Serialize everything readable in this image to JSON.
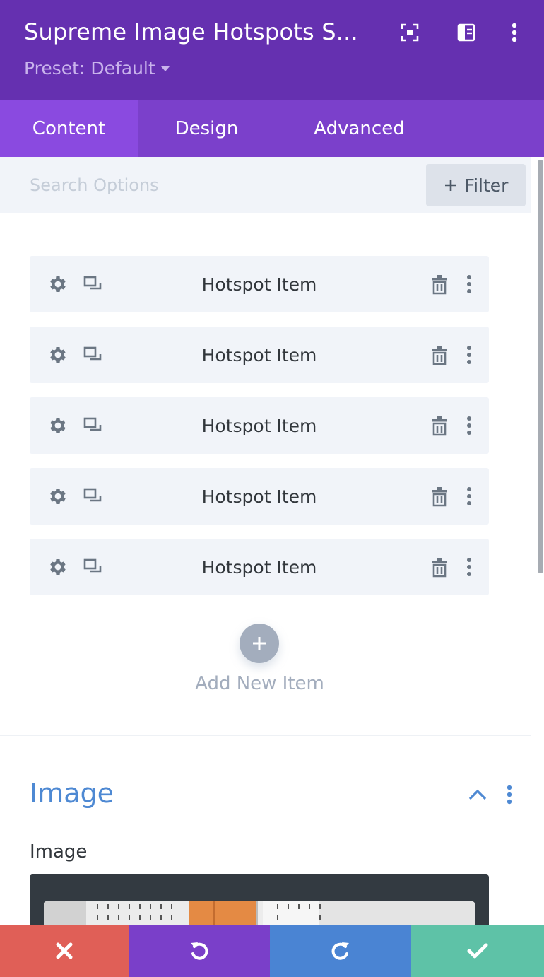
{
  "header": {
    "title": "Supreme Image Hotspots S...",
    "preset_label": "Preset: Default",
    "icons": [
      "focus-mode-icon",
      "sidebar-layout-icon",
      "more-vertical-icon"
    ]
  },
  "tabs": [
    {
      "label": "Content",
      "active": true
    },
    {
      "label": "Design",
      "active": false
    },
    {
      "label": "Advanced",
      "active": false
    }
  ],
  "search": {
    "placeholder": "Search Options",
    "value": ""
  },
  "filter": {
    "label": "Filter"
  },
  "items": [
    {
      "label": "Hotspot Item"
    },
    {
      "label": "Hotspot Item"
    },
    {
      "label": "Hotspot Item"
    },
    {
      "label": "Hotspot Item"
    },
    {
      "label": "Hotspot Item"
    }
  ],
  "add_item": {
    "label": "Add New Item"
  },
  "section": {
    "title": "Image",
    "field_label": "Image"
  },
  "footer": {
    "buttons": [
      {
        "name": "discard",
        "icon": "close-icon",
        "color": "#e05f57"
      },
      {
        "name": "undo",
        "icon": "undo-icon",
        "color": "#7a3fc9"
      },
      {
        "name": "redo",
        "icon": "redo-icon",
        "color": "#4a84d3"
      },
      {
        "name": "save",
        "icon": "check-icon",
        "color": "#5ec2a7"
      }
    ]
  },
  "colors": {
    "header_bg": "#6530b0",
    "tabs_bg": "#7b40cb",
    "tab_active_bg": "#8a4ae0",
    "section_title": "#4e89d3",
    "item_bg": "#f1f4f9"
  }
}
